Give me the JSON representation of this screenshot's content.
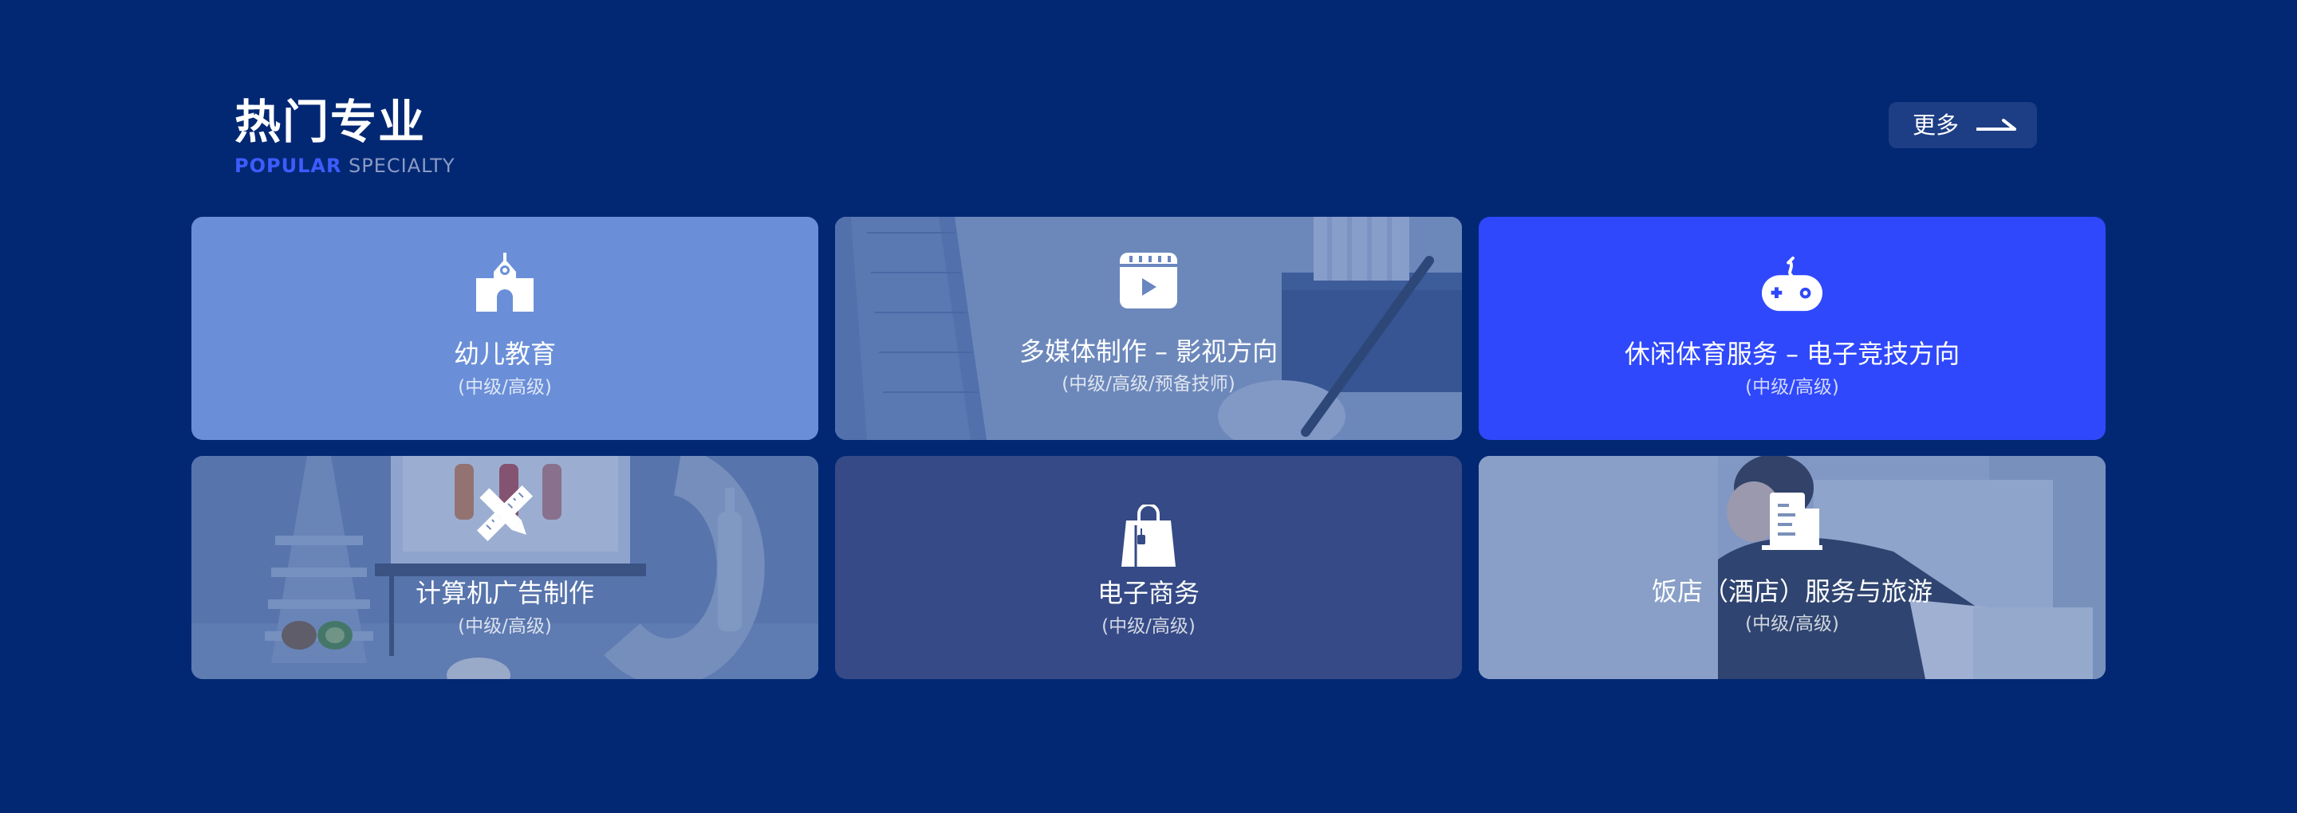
{
  "header": {
    "title": "热门专业",
    "subtitle_accent": "POPULAR",
    "subtitle_rest": " SPECIALTY",
    "more_label": "更多"
  },
  "colors": {
    "background": "#022874",
    "card_light_blue": "#6a8fd8",
    "card_bright_blue": "#2f48fb",
    "card_slate_blue": "#354a86",
    "accent_text": "#3d5cff"
  },
  "cards": [
    {
      "title": "幼儿教育",
      "level": "(中级/高级)",
      "icon": "school-building-icon"
    },
    {
      "title": "多媒体制作 – 影视方向",
      "level": "(中级/高级/预备技师)",
      "icon": "video-clapper-icon"
    },
    {
      "title": "休闲体育服务 – 电子竞技方向",
      "level": "(中级/高级)",
      "icon": "gamepad-icon"
    },
    {
      "title": "计算机广告制作",
      "level": "(中级/高级)",
      "icon": "ruler-pencil-icon"
    },
    {
      "title": "电子商务",
      "level": "(中级/高级)",
      "icon": "shopping-bag-icon"
    },
    {
      "title": "饭店（酒店）服务与旅游",
      "level": "(中级/高级)",
      "icon": "menu-document-icon"
    }
  ]
}
